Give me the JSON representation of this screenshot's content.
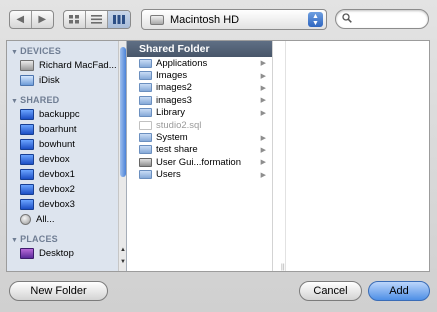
{
  "toolbar": {
    "nav_back": "◀",
    "nav_forward": "▶",
    "view_icons": [
      "icon-view-icon",
      "list-view-icon",
      "column-view-icon"
    ],
    "location": "Macintosh HD",
    "search_value": "",
    "search_placeholder": ""
  },
  "sidebar": {
    "sections": [
      {
        "title": "DEVICES",
        "items": [
          {
            "label": "Richard MacFad...",
            "icon": "hard-drive-icon"
          },
          {
            "label": "iDisk",
            "icon": "idisk-icon"
          }
        ]
      },
      {
        "title": "SHARED",
        "items": [
          {
            "label": "backuppc",
            "icon": "computer-icon"
          },
          {
            "label": "boarhunt",
            "icon": "computer-icon"
          },
          {
            "label": "bowhunt",
            "icon": "computer-icon"
          },
          {
            "label": "devbox",
            "icon": "computer-icon"
          },
          {
            "label": "devbox1",
            "icon": "computer-icon"
          },
          {
            "label": "devbox2",
            "icon": "computer-icon"
          },
          {
            "label": "devbox3",
            "icon": "computer-icon"
          },
          {
            "label": "All...",
            "icon": "globe-icon"
          }
        ]
      },
      {
        "title": "PLACES",
        "items": [
          {
            "label": "Desktop",
            "icon": "desktop-icon"
          }
        ]
      }
    ]
  },
  "column1": {
    "header": "Shared Folder",
    "rows": [
      {
        "label": "Applications",
        "icon": "folder-icon",
        "has_children": true
      },
      {
        "label": "Images",
        "icon": "folder-icon",
        "has_children": true
      },
      {
        "label": "images2",
        "icon": "folder-icon",
        "has_children": true
      },
      {
        "label": "images3",
        "icon": "folder-icon",
        "has_children": true
      },
      {
        "label": "Library",
        "icon": "folder-icon",
        "has_children": true
      },
      {
        "label": "studio2.sql",
        "icon": "document-icon",
        "has_children": false,
        "disabled": true
      },
      {
        "label": "System",
        "icon": "folder-icon",
        "has_children": true
      },
      {
        "label": "test share",
        "icon": "folder-icon",
        "has_children": true
      },
      {
        "label": "User Gui...formation",
        "icon": "application-icon",
        "has_children": true
      },
      {
        "label": "Users",
        "icon": "folder-icon",
        "has_children": true
      }
    ]
  },
  "buttons": {
    "new_folder": "New Folder",
    "cancel": "Cancel",
    "add": "Add"
  }
}
